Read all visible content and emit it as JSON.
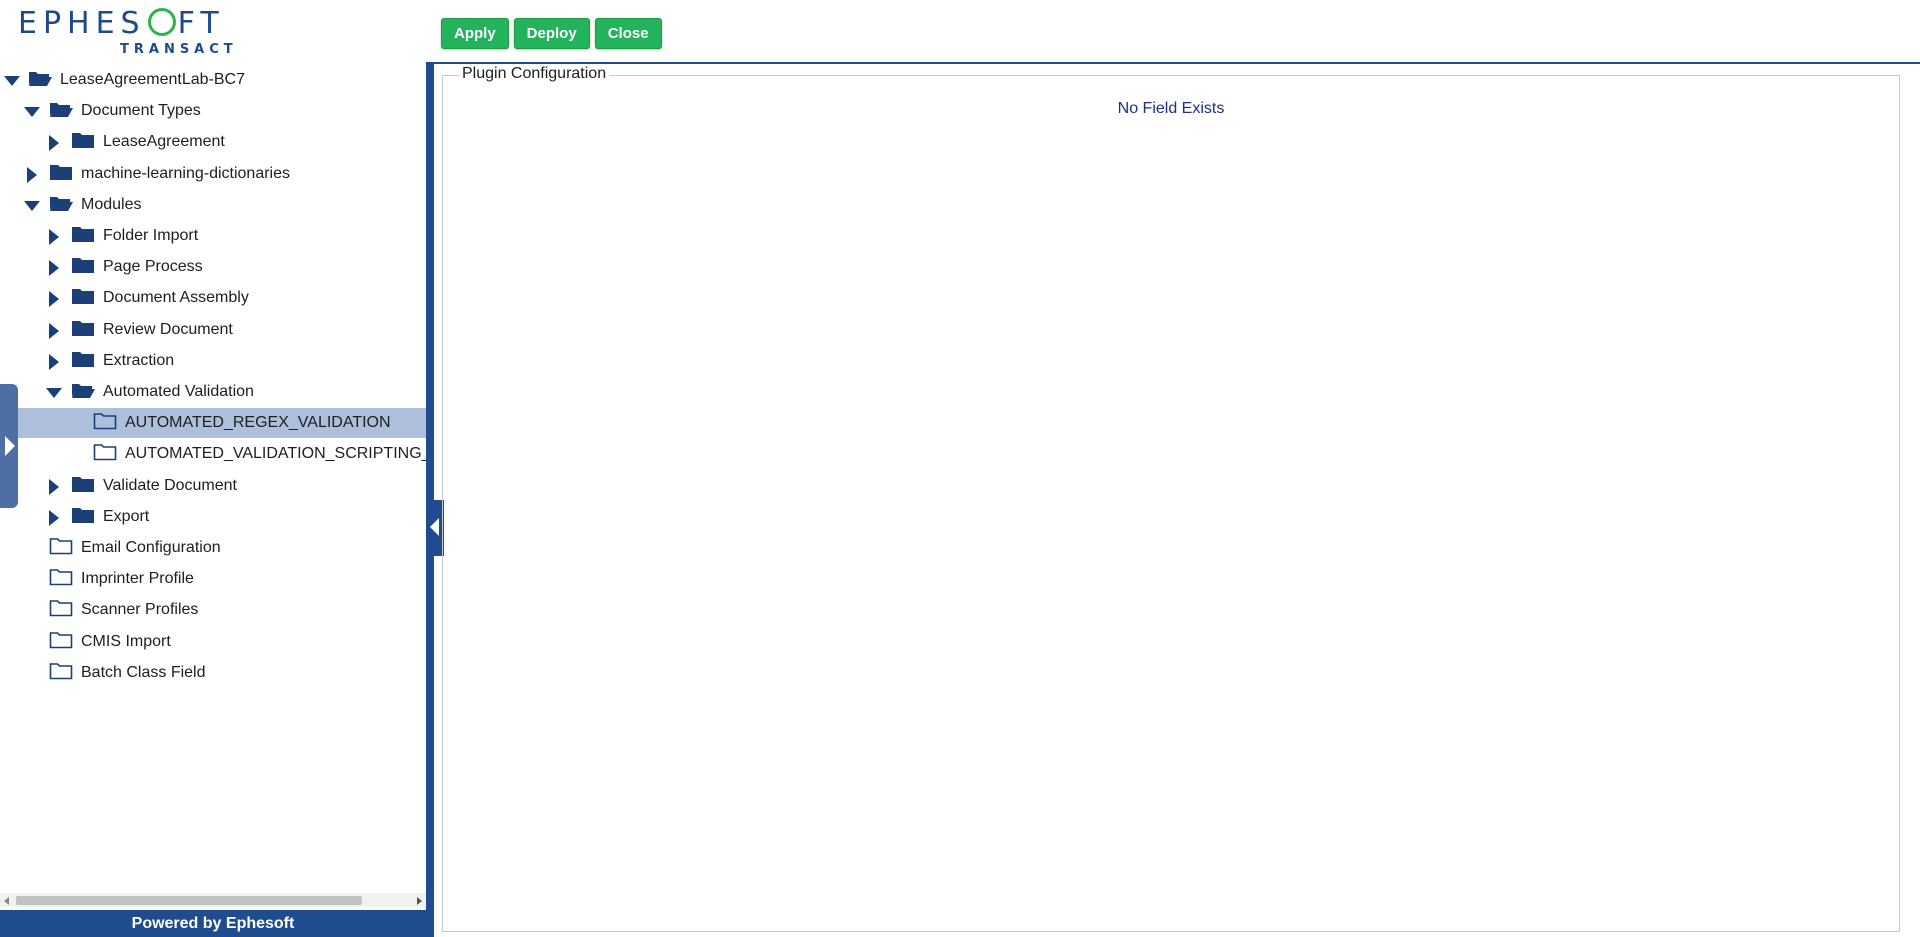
{
  "brand": {
    "name": "EPHES",
    "name_end": "FT",
    "sub": "TRANSACT"
  },
  "toolbar": {
    "apply": "Apply",
    "deploy": "Deploy",
    "close": "Close"
  },
  "tree": [
    {
      "label": "LeaseAgreementLab-BC7",
      "state": "open",
      "icon": "folder-open-icon"
    },
    {
      "label": "Document Types",
      "state": "open",
      "icon": "folder-open-icon"
    },
    {
      "label": "LeaseAgreement",
      "state": "closed",
      "icon": "folder-icon"
    },
    {
      "label": "machine-learning-dictionaries",
      "state": "closed",
      "icon": "folder-icon"
    },
    {
      "label": "Modules",
      "state": "open",
      "icon": "folder-open-icon"
    },
    {
      "label": "Folder Import",
      "state": "closed",
      "icon": "folder-icon"
    },
    {
      "label": "Page Process",
      "state": "closed",
      "icon": "folder-icon"
    },
    {
      "label": "Document Assembly",
      "state": "closed",
      "icon": "folder-icon"
    },
    {
      "label": "Review Document",
      "state": "closed",
      "icon": "folder-icon"
    },
    {
      "label": "Extraction",
      "state": "closed",
      "icon": "folder-icon"
    },
    {
      "label": "Automated Validation",
      "state": "open",
      "icon": "folder-open-icon"
    },
    {
      "label": "AUTOMATED_REGEX_VALIDATION",
      "state": "leaf",
      "icon": "folder-outline-icon",
      "selected": true
    },
    {
      "label": "AUTOMATED_VALIDATION_SCRIPTING_PLUGIN",
      "state": "leaf",
      "icon": "folder-outline-icon"
    },
    {
      "label": "Validate Document",
      "state": "closed",
      "icon": "folder-icon"
    },
    {
      "label": "Export",
      "state": "closed",
      "icon": "folder-icon"
    },
    {
      "label": "Email Configuration",
      "state": "leaf",
      "icon": "folder-outline-icon"
    },
    {
      "label": "Imprinter Profile",
      "state": "leaf",
      "icon": "folder-outline-icon"
    },
    {
      "label": "Scanner Profiles",
      "state": "leaf",
      "icon": "folder-outline-icon"
    },
    {
      "label": "CMIS Import",
      "state": "leaf",
      "icon": "folder-outline-icon"
    },
    {
      "label": "Batch Class Field",
      "state": "leaf",
      "icon": "folder-outline-icon"
    }
  ],
  "footer": {
    "text": "Powered by Ephesoft"
  },
  "main": {
    "section_title": "Plugin Configuration",
    "empty_message": "No Field Exists"
  },
  "colors": {
    "brand_blue": "#1d4a8c",
    "accent_green": "#22b35c",
    "selection": "#aebfdb"
  }
}
